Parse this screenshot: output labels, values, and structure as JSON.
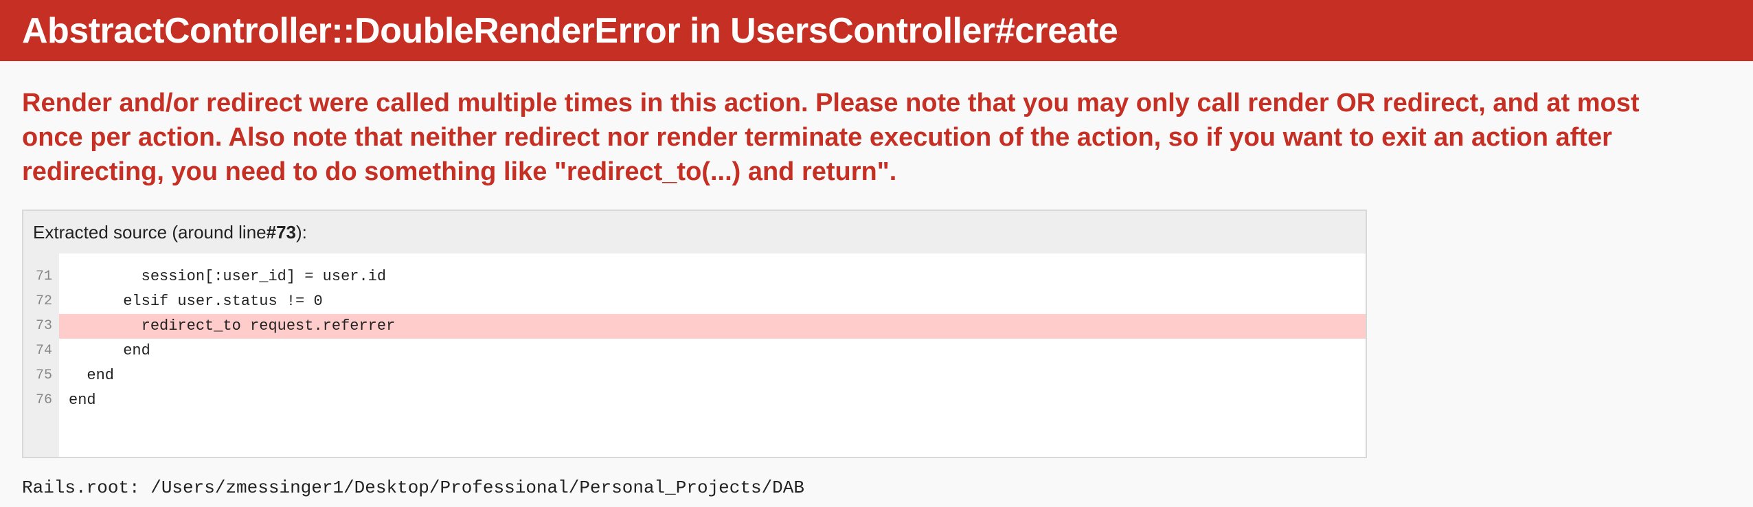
{
  "header": {
    "title": "AbstractController::DoubleRenderError in UsersController#create"
  },
  "message": "Render and/or redirect were called multiple times in this action. Please note that you may only call render OR redirect, and at most once per action. Also note that neither redirect nor render terminate execution of the action, so if you want to exit an action after redirecting, you need to do something like \"redirect_to(...) and return\".",
  "source": {
    "title_prefix": "Extracted source (around line ",
    "title_line": "#73",
    "title_suffix": "):",
    "lines": [
      {
        "number": "71",
        "code": "        session[:user_id] = user.id"
      },
      {
        "number": "72",
        "code": "      elsif user.status != 0"
      },
      {
        "number": "73",
        "code": "        redirect_to request.referrer"
      },
      {
        "number": "74",
        "code": "      end"
      },
      {
        "number": "75",
        "code": "  end"
      },
      {
        "number": "76",
        "code": "end"
      }
    ]
  },
  "rails_root": "Rails.root: /Users/zmessinger1/Desktop/Professional/Personal_Projects/DAB",
  "colors": {
    "header_bg": "#c52f24",
    "message_text": "#c52f24",
    "highlight_line": "#ffcccc"
  }
}
